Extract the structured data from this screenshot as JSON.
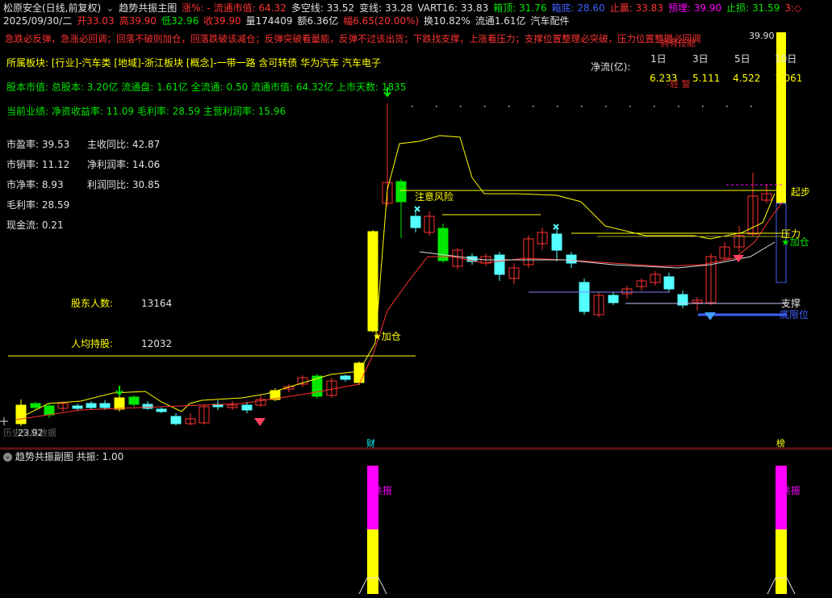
{
  "header": {
    "row1": [
      {
        "text": "松原安全(日线,前复权)",
        "color": "#e0e0e0"
      },
      {
        "text": "⌄",
        "color": "#999999"
      },
      {
        "text": "趋势共振主图",
        "color": "#e0e0e0"
      },
      {
        "text": "涨%: - 流通市值: 64.32",
        "color": "#ff3232"
      },
      {
        "text": "多空线: 33.52",
        "color": "#e0e0e0"
      },
      {
        "text": "变线: 33.28",
        "color": "#e0e0e0"
      },
      {
        "text": "VART16: 33.83",
        "color": "#e0e0e0"
      },
      {
        "text": "箱顶: 31.76",
        "color": "#00e600"
      },
      {
        "text": "箱底: 28.60",
        "color": "#4060ff"
      },
      {
        "text": "止赢: 33.83",
        "color": "#ff3232"
      },
      {
        "text": "预埋: 39.90",
        "color": "#ff00ff"
      },
      {
        "text": "止损: 31.59",
        "color": "#00e600"
      },
      {
        "text": "3:◇",
        "color": "#ff3232"
      }
    ],
    "row2": [
      {
        "text": "2025/09/30/二",
        "color": "#e0e0e0"
      },
      {
        "text": "开33.03",
        "color": "#ff3232"
      },
      {
        "text": "高39.90",
        "color": "#ff3232"
      },
      {
        "text": "低32.96",
        "color": "#00e600"
      },
      {
        "text": "收39.90",
        "color": "#ff3232"
      },
      {
        "text": "量174409",
        "color": "#e0e0e0"
      },
      {
        "text": "额6.36亿",
        "color": "#e0e0e0"
      },
      {
        "text": "幅6.65(20.00%)",
        "color": "#ff3232"
      },
      {
        "text": "换10.82%",
        "color": "#e0e0e0"
      },
      {
        "text": "流通1.61亿",
        "color": "#e0e0e0"
      },
      {
        "text": "汽车配件",
        "color": "#e0e0e0"
      }
    ]
  },
  "warning_text": "急跌必反弹，急涨必回调；回落不破则加仓，回落跌破该减仓；反弹突破看量能，反弹不过该出货；下跌找支撑，上涨看压力；支撑位置整理必突破，压力位置整理必回调",
  "info": {
    "sector": "所属板块: [行业]-汽车类 [地域]-浙江板块 [概念]-一带一路 含可转债 华为汽车 汽车电子",
    "equity": "股本市值: 总股本: 3.20亿 流通盘: 1.61亿 全流通: 0.50 流通市值: 64.32亿 上市天数: 1835",
    "perf": "当前业绩: 净资收益率: 11.09 毛利率: 28.59 主营利润率: 15.96"
  },
  "ratios_left": [
    {
      "label": "市盈率: 39.53"
    },
    {
      "label": "市销率: 11.12"
    },
    {
      "label": "市净率: 8.93"
    },
    {
      "label": "毛利率: 28.59"
    },
    {
      "label": "现金流: 0.21"
    }
  ],
  "ratios_right": [
    {
      "label": "主收同比: 42.87"
    },
    {
      "label": "净利润率: 14.06"
    },
    {
      "label": "利润同比: 30.85"
    }
  ],
  "holders": {
    "count_label": "股东人数:",
    "count_value": "13164",
    "avg_label": "人均持股:",
    "avg_value": "12032"
  },
  "netflow": {
    "title": "净流(亿):",
    "headers": [
      "1日",
      "3日",
      "5日",
      "10日"
    ],
    "values": [
      "6.233",
      "5.111",
      "4.522",
      "1.061"
    ],
    "note_top": "拥有技能",
    "note_mid": "-轻 警"
  },
  "annotations": {
    "attention": "注意风险",
    "jiacang1": "★加仓",
    "qibu": "起步",
    "yali": "压力",
    "jiacang2": "★加仓",
    "zhicheng": "支撑",
    "dixian": "底限位",
    "price_top": "39.90",
    "price_low": "23.92",
    "left_watermark": "历史交易数据",
    "bottom_tag_cai": "财",
    "bottom_tag_bang": "榜"
  },
  "subchart": {
    "title": "趋势共振副图",
    "value_label": "共振: 1.00",
    "bar_label": "共振"
  },
  "colors": {
    "up": "#ff3232",
    "down_cyan": "#54ffff",
    "green": "#00e600",
    "yellow": "#ffff00",
    "magenta": "#ff00ff",
    "blue": "#4060ff",
    "bg": "#000000"
  }
}
